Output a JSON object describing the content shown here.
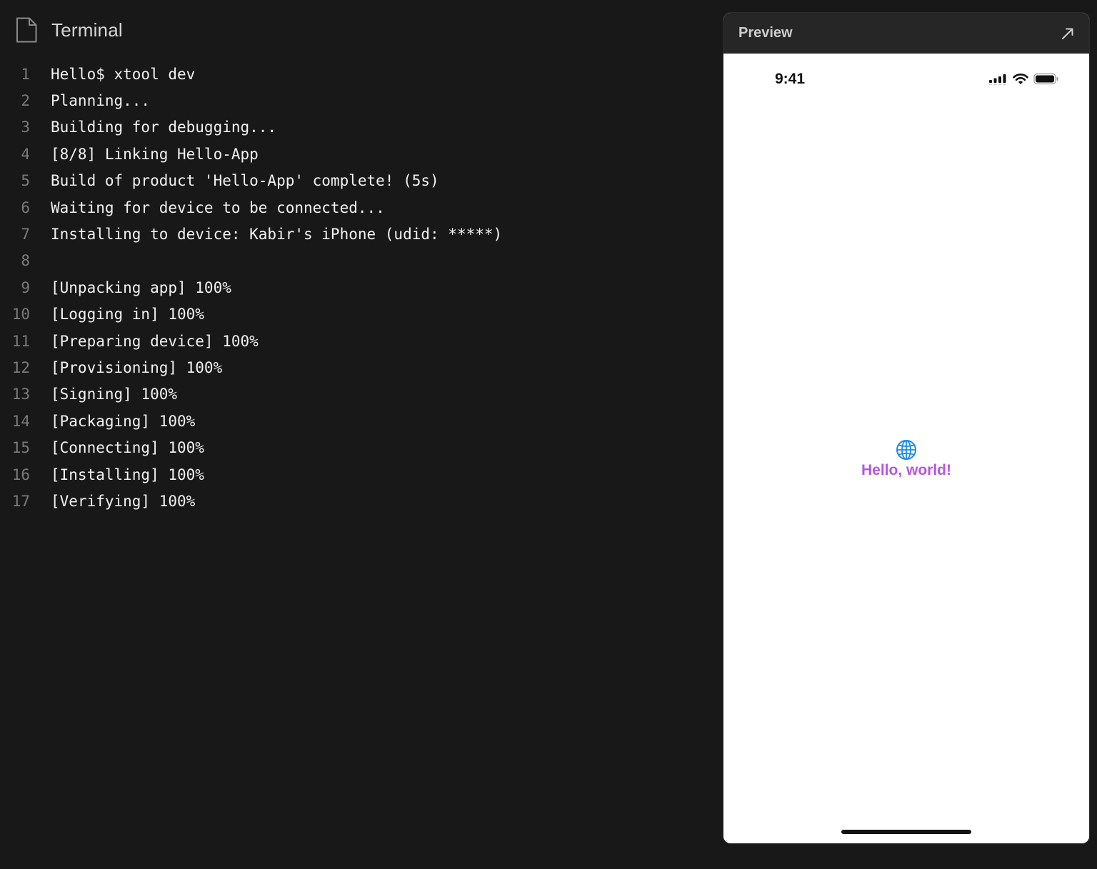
{
  "terminal": {
    "title": "Terminal",
    "lines": [
      {
        "num": "1",
        "text": "Hello$ xtool dev"
      },
      {
        "num": "2",
        "text": "Planning..."
      },
      {
        "num": "3",
        "text": "Building for debugging..."
      },
      {
        "num": "4",
        "text": "[8/8] Linking Hello-App"
      },
      {
        "num": "5",
        "text": "Build of product 'Hello-App' complete! (5s)"
      },
      {
        "num": "6",
        "text": "Waiting for device to be connected..."
      },
      {
        "num": "7",
        "text": "Installing to device: Kabir's iPhone (udid: *****)"
      },
      {
        "num": "8",
        "text": ""
      },
      {
        "num": "9",
        "text": "[Unpacking app] 100%"
      },
      {
        "num": "10",
        "text": "[Logging in] 100%"
      },
      {
        "num": "11",
        "text": "[Preparing device] 100%"
      },
      {
        "num": "12",
        "text": "[Provisioning] 100%"
      },
      {
        "num": "13",
        "text": "[Signing] 100%"
      },
      {
        "num": "14",
        "text": "[Packaging] 100%"
      },
      {
        "num": "15",
        "text": "[Connecting] 100%"
      },
      {
        "num": "16",
        "text": "[Installing] 100%"
      },
      {
        "num": "17",
        "text": "[Verifying] 100%"
      }
    ]
  },
  "preview": {
    "title": "Preview",
    "expand_icon": "arrow-up-right-icon",
    "status_bar": {
      "time": "9:41",
      "icons": [
        "cellular-signal-icon",
        "wifi-icon",
        "battery-icon"
      ]
    },
    "content": {
      "icon": "globe-icon",
      "text": "Hello, world!"
    }
  },
  "colors": {
    "background": "#181818",
    "terminal_text": "#f2f2f2",
    "line_number": "#7a7a7a",
    "preview_header": "#262626",
    "hello_text": "#b755e0",
    "globe": "#1a8ae6"
  }
}
